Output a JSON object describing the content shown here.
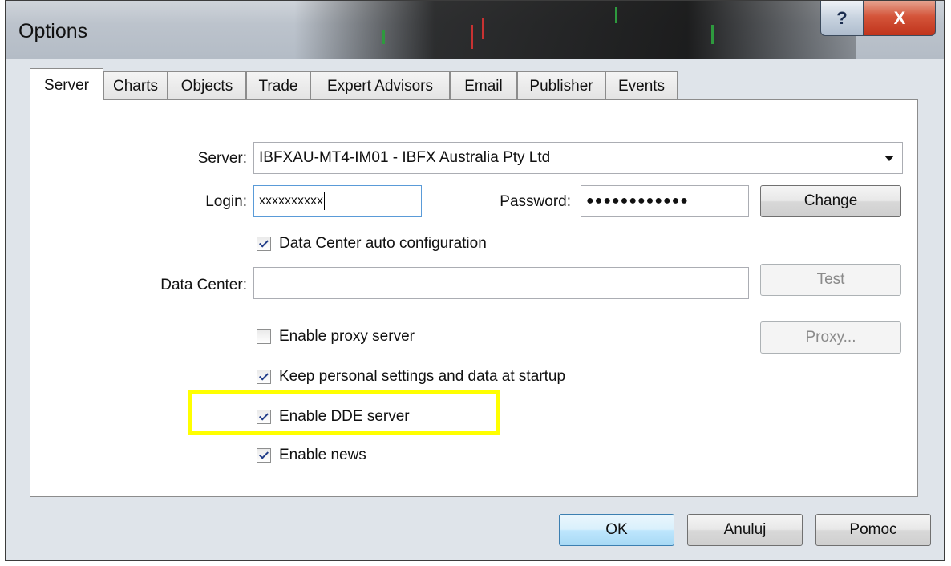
{
  "window": {
    "title": "Options",
    "help_glyph": "?",
    "close_glyph": "X"
  },
  "tabs": [
    {
      "label": "Server",
      "active": true
    },
    {
      "label": "Charts"
    },
    {
      "label": "Objects"
    },
    {
      "label": "Trade"
    },
    {
      "label": "Expert Advisors"
    },
    {
      "label": "Email"
    },
    {
      "label": "Publisher"
    },
    {
      "label": "Events"
    }
  ],
  "server": {
    "server_label": "Server:",
    "server_value": "IBFXAU-MT4-IM01 - IBFX Australia Pty Ltd",
    "login_label": "Login:",
    "login_value": "xxxxxxxxxx",
    "password_label": "Password:",
    "password_value": "●●●●●●●●●●●●",
    "change_label": "Change",
    "dc_auto_label": "Data Center auto configuration",
    "dc_label": "Data Center:",
    "dc_value": "",
    "test_label": "Test",
    "proxy_enable_label": "Enable proxy server",
    "proxy_button_label": "Proxy...",
    "keep_settings_label": "Keep personal settings and data at startup",
    "dde_label": "Enable DDE server",
    "news_label": "Enable news"
  },
  "checkboxes": {
    "dc_auto": true,
    "proxy": false,
    "keep_settings": true,
    "dde": true,
    "news": true
  },
  "footer": {
    "ok_label": "OK",
    "cancel_label": "Anuluj",
    "help_label": "Pomoc"
  },
  "colors": {
    "highlight": "#ffff00",
    "close_button": "#c0331b",
    "default_button": "#bee6fd"
  }
}
